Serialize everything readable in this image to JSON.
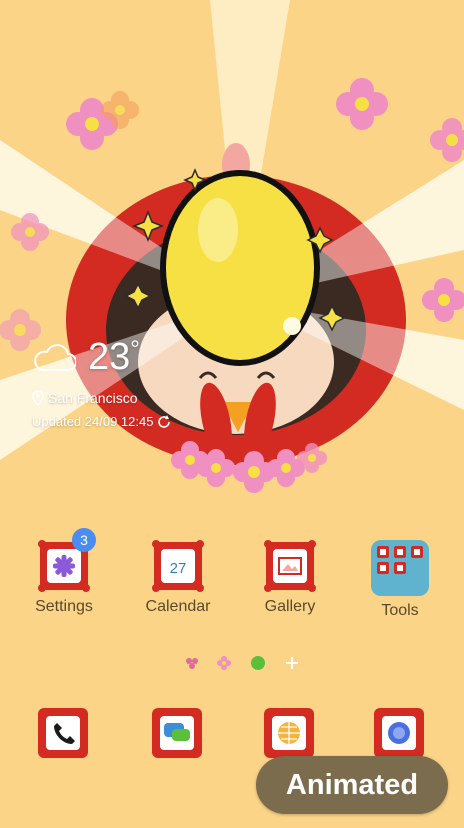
{
  "wallpaper": {
    "background": "#fbd488",
    "accent_red": "#d32b22",
    "egg_yellow": "#f6e043",
    "flower_pink": "#f090c0"
  },
  "weather": {
    "temperature": "23",
    "degree": "°",
    "location": "San Francisco",
    "updated": "Updated 24/09 12:45"
  },
  "apps": [
    {
      "label": "Settings",
      "badge": "3",
      "icon": "settings-gear-icon"
    },
    {
      "label": "Calendar",
      "date": "27",
      "icon": "calendar-icon"
    },
    {
      "label": "Gallery",
      "icon": "gallery-icon"
    },
    {
      "label": "Tools",
      "icon": "tools-folder-icon"
    }
  ],
  "dock": [
    {
      "icon": "phone-icon"
    },
    {
      "icon": "messages-icon"
    },
    {
      "icon": "browser-globe-icon"
    },
    {
      "icon": "internet-icon"
    }
  ],
  "page_indicator": {
    "current": 3,
    "total": 4
  },
  "overlay": {
    "button_label": "Animated"
  }
}
